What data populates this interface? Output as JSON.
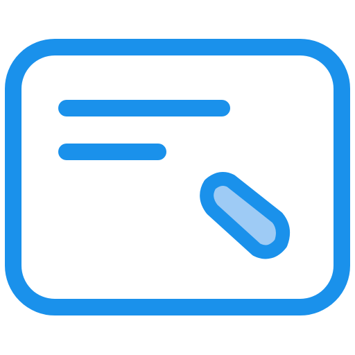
{
  "icon": {
    "name": "card-with-pen-icon",
    "colors": {
      "stroke": "#1A91EB",
      "accent_fill": "#9ECBF5",
      "background": "#FFFFFF"
    }
  }
}
